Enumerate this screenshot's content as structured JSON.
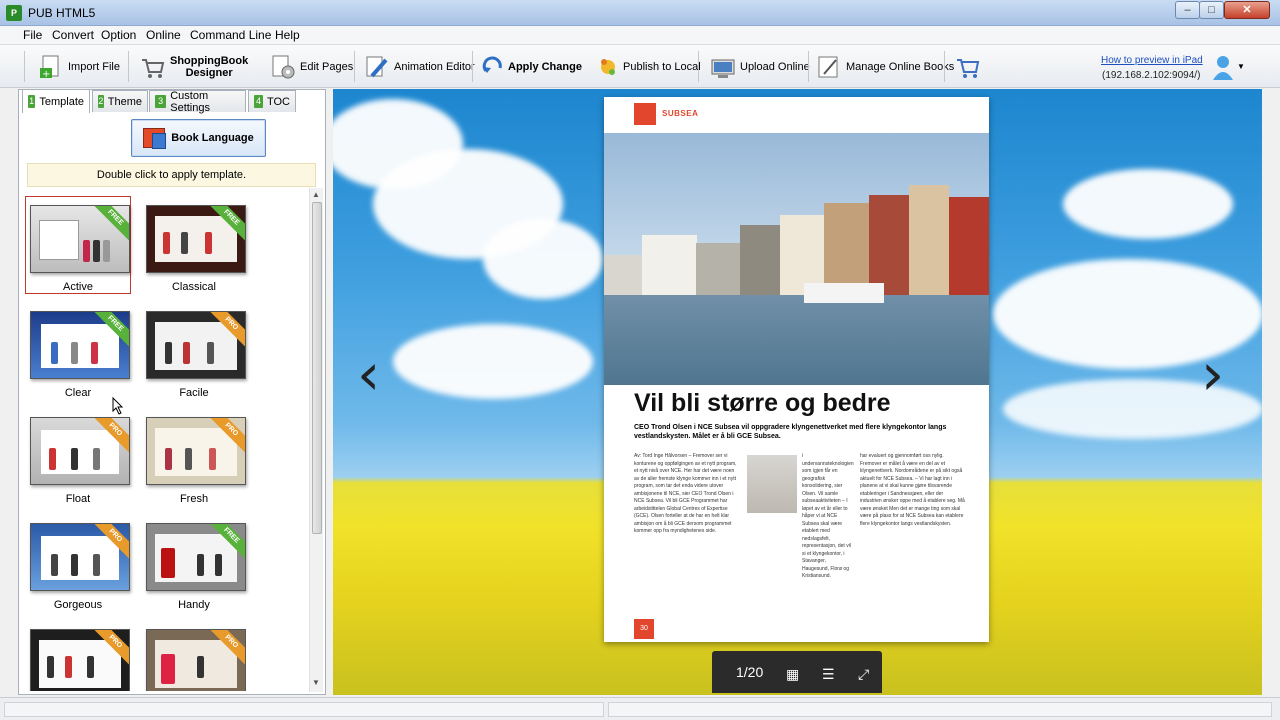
{
  "window": {
    "title": "PUB HTML5",
    "min": "–",
    "max": "□",
    "close": "✕"
  },
  "menu": [
    "File",
    "Convert",
    "Option",
    "Online",
    "Command Line",
    "Help"
  ],
  "toolbar": {
    "import": "Import File",
    "shopping_line1": "ShoppingBook",
    "shopping_line2": "Designer",
    "edit_pages": "Edit Pages",
    "animation": "Animation Editor",
    "apply": "Apply Change",
    "publish": "Publish to Local",
    "upload": "Upload Online",
    "manage": "Manage Online Books",
    "preview_link": "How to preview in iPad",
    "preview_ip": "(192.168.2.102:9094/)"
  },
  "tabs": [
    {
      "num": "1",
      "label": "Template"
    },
    {
      "num": "2",
      "label": "Theme"
    },
    {
      "num": "3",
      "label": "Custom Settings"
    },
    {
      "num": "4",
      "label": "TOC"
    }
  ],
  "book_language": "Book Language",
  "hint": "Double click to apply template.",
  "templates": [
    {
      "name": "Active",
      "badge": "FREE"
    },
    {
      "name": "Classical",
      "badge": "FREE"
    },
    {
      "name": "Clear",
      "badge": "FREE"
    },
    {
      "name": "Facile",
      "badge": "PRO"
    },
    {
      "name": "Float",
      "badge": "PRO"
    },
    {
      "name": "Fresh",
      "badge": "PRO"
    },
    {
      "name": "Gorgeous",
      "badge": "PRO"
    },
    {
      "name": "Handy",
      "badge": "FREE"
    },
    {
      "name": "",
      "badge": "PRO"
    },
    {
      "name": "",
      "badge": "PRO"
    }
  ],
  "book": {
    "section": "SUBSEA",
    "headline": "Vil bli større og bedre",
    "deck": "CEO Trond Olsen i NCE Subsea vil oppgradere klyngenettverket med flere klyngekontor langs vestlandskysten. Målet er å bli GCE Subsea.",
    "col1": "Av: Tord Inge Hålvorsen – Fremover ser vi konturene og oppfølgingen av et nytt program, et nytt nivå over NCE. Her har det være noen av de aller fremste klynge kommer inn i et nytt program, som tar det enda videre utover ambisjonene til NCE, sier CEO Trond Olsen i NCE Subsea. Vil bli GCE Programmet har arbeidstittelen Global Centres of Expertise (GCE). Olsen forteller at de har en helt klar ambisjon om å bli GCE dersom programmet kommer opp fra myndighetenes side.",
    "col2": "i undervannsteknologien, som igjen får en geografisk konsolidering, sier Olsen. Vil samle subseaaktiviteten – I løpet av et år eller to håper vi at NCE Subsea skal være etablert med nedslagsfelt, representasjon, det vil si et klyngekontor, i Stavanger, Haugesund, Florø og Kristiansund.",
    "col3": "har evaluert og gjennomført oss nylig. Fremover er målet å være en del av et klyngenettverk. Nordområdene er på sikt også aktuelt for NCE Subsea. – Vi har lagt inn i planene at vi skal kunne gjøre tilsvarende etableringer i Sandnessjøen, eller der industrien ønsker oppe med å etablere seg. Må være ønsket Men det er mange ting som skal være på plass for at NCE Subsea kan etablere flere klyngekontor langs vestlandskysten.",
    "page_num": "30",
    "pager": "1/20"
  },
  "colors": {
    "accent": "#e2462d",
    "free": "#58b13a",
    "pro": "#e89a2a"
  }
}
